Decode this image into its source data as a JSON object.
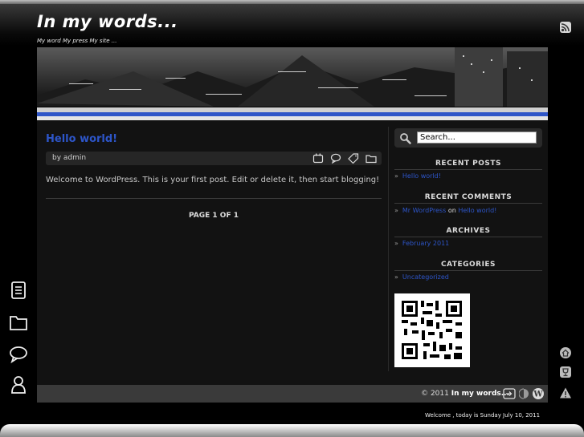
{
  "site": {
    "title": "In my words...",
    "description": "My word My press My site ..."
  },
  "post": {
    "title": "Hello world!",
    "byline": "by admin",
    "body": "Welcome to WordPress. This is your first post. Edit or delete it, then start blogging!",
    "pagination": "PAGE 1 OF 1",
    "meta_icons": [
      "calendar-icon",
      "comment-icon",
      "tag-icon",
      "folder-icon"
    ]
  },
  "search": {
    "value": "Search..."
  },
  "sidebar": {
    "recent_posts": {
      "title": "RECENT POSTS",
      "items": [
        "Hello world!"
      ]
    },
    "recent_comments": {
      "title": "RECENT COMMENTS",
      "author": "Mr WordPress",
      "on": "on",
      "post": "Hello world!"
    },
    "archives": {
      "title": "ARCHIVES",
      "items": [
        "February 2011"
      ]
    },
    "categories": {
      "title": "CATEGORIES",
      "items": [
        "Uncategorized"
      ]
    }
  },
  "footer": {
    "copyright_prefix": "© 2011",
    "site_name": "In my words...",
    "welcome": "Welcome , today is Sunday July 10, 2011"
  },
  "left_nav": [
    "posts-icon",
    "folder-icon",
    "comments-icon",
    "user-icon"
  ],
  "right_icons": [
    "home-icon",
    "trophy-icon",
    "warning-icon"
  ],
  "colors": {
    "link": "#2d55c8",
    "background": "#000000",
    "content_bg": "#121212",
    "accent_stripe": "#2f56c8"
  }
}
